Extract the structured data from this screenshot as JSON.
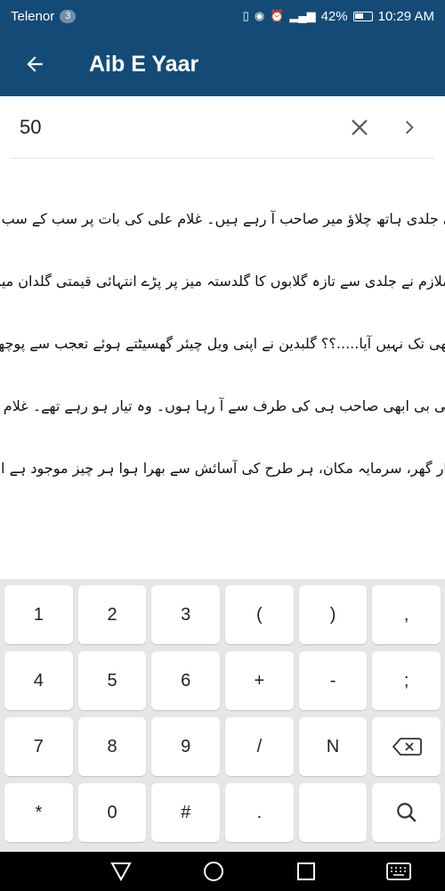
{
  "status_bar": {
    "carrier": "Telenor",
    "carrier_badge": "3",
    "battery": "42%",
    "time": "10:29 AM"
  },
  "app_bar": {
    "title": "Aib E Yaar",
    "background": "#134b76"
  },
  "search": {
    "value": "50"
  },
  "content": {
    "paragraphs": [
      "جلدی جلدی ہاتھ چلاؤ میر صاحب آ رہے ہیں۔ غلام علی کی بات پر سب کے سب اپنے اپنے کاموں میں مصروف ہو گئے۔ بلکہ وہ ملازم جو ابھی تک ٹیبل کے پاس کھڑے غلام علی کے حکم کا انتظار کر رہے تھے۔",
      "ایک ملازم نے جلدی سے تازہ گلابوں کا گلدستہ میز پر پڑے انتہائی قیمتی گلدان میں لگایا جس سے اس کمرے کی خوبصورتی میں مزید چار چاند لگ گئے جبکہ خانساماں میز پر ناشتے کے لوازمات لگانے لگا۔",
      "کیا ابھی تک نہیں آیا.....؟؟ گلبدین نے اپنی ویل چیئر گھسیٹتے ہوئے تعجب سے پوچھا",
      "جی بی بی ابھی صاحب ہی کی طرف سے آ رہا ہوں۔ وہ تیار ہو رہے تھے۔ غلام علی کے جواب پر گلبدین بیگم اپنی ویل چیئر دھکیلتی ہوئی اپنی جگہ پر آ رکیں۔",
      "شاندار گھر، سرمایہ مکان، ہر طرح کی آسائش سے بھرا ہوا ہر چیز موجود ہے اور جو نہیں ہے وہ میر صاحب"
    ]
  },
  "keyboard": {
    "rows": [
      [
        "1",
        "2",
        "3",
        "(",
        ")",
        ","
      ],
      [
        "4",
        "5",
        "6",
        "+",
        "-",
        ";"
      ],
      [
        "7",
        "8",
        "9",
        "/",
        "N",
        "backspace"
      ],
      [
        "*",
        "0",
        "#",
        ".",
        " ",
        "search"
      ]
    ]
  }
}
